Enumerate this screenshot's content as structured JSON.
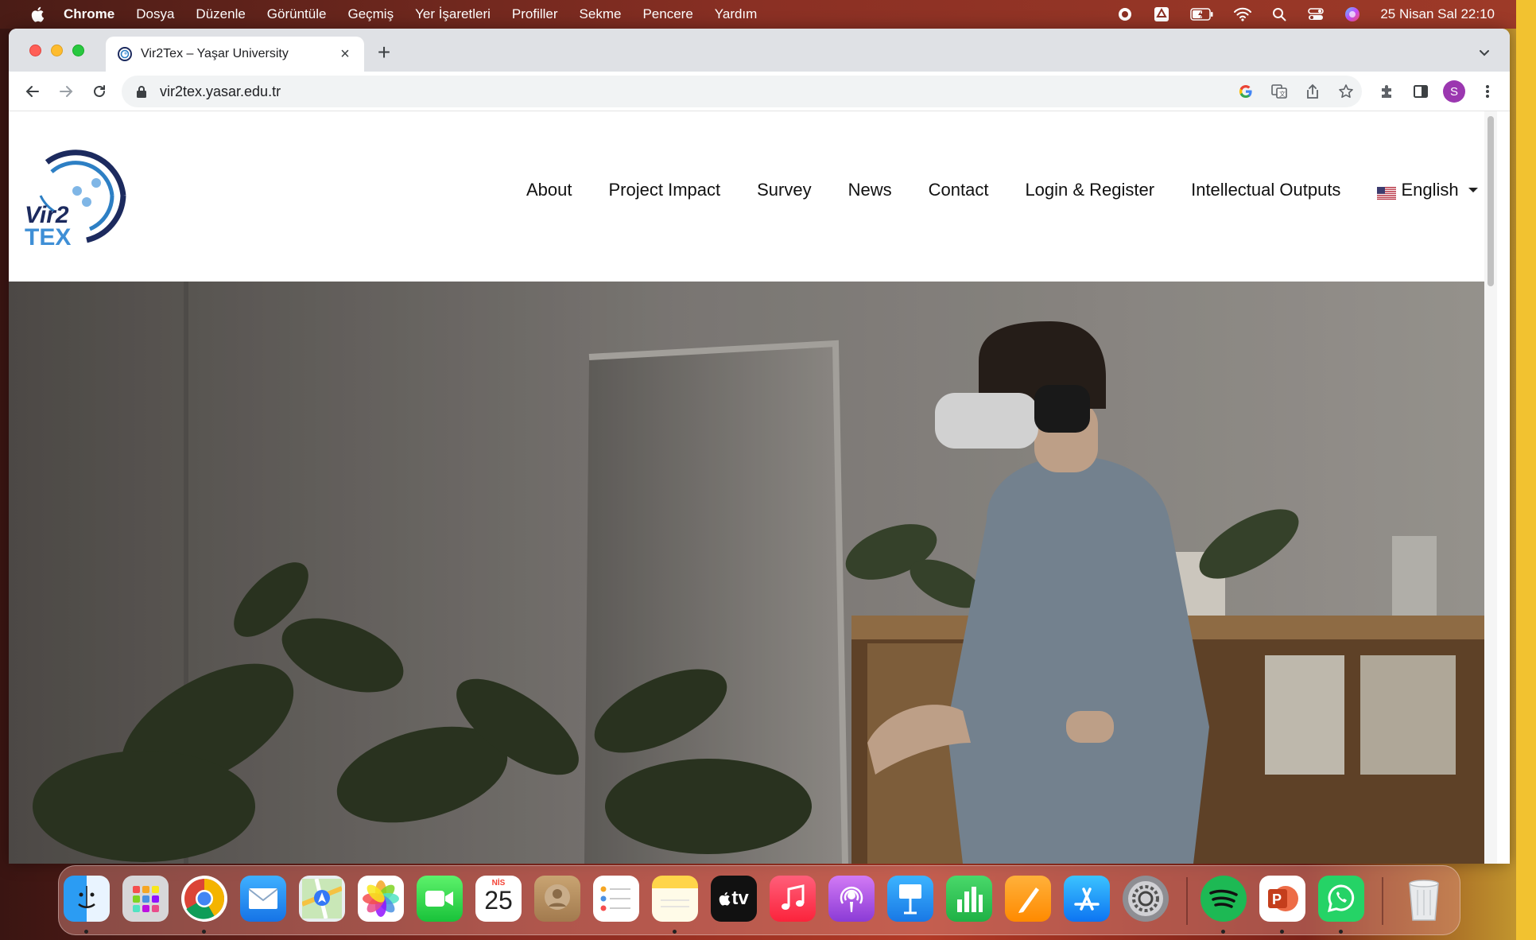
{
  "menubar": {
    "app": "Chrome",
    "items": [
      "Dosya",
      "Düzenle",
      "Görüntüle",
      "Geçmiş",
      "Yer İşaretleri",
      "Profiller",
      "Sekme",
      "Pencere",
      "Yardım"
    ],
    "status_icons": [
      "record-icon",
      "drive-icon",
      "battery-icon",
      "wifi-icon",
      "search-icon",
      "control-center-icon",
      "siri-icon"
    ],
    "clock": "25 Nisan Sal  22:10"
  },
  "browser": {
    "tab_title": "Vir2Tex – Yaşar University",
    "url": "vir2tex.yasar.edu.tr",
    "profile_initial": "S"
  },
  "site": {
    "logo_text_top": "Vir2",
    "logo_text_bottom": "TEX",
    "nav": [
      "About",
      "Project Impact",
      "Survey",
      "News",
      "Contact",
      "Login & Register",
      "Intellectual Outputs"
    ],
    "language": "English"
  },
  "dock": {
    "calendar_month": "NİS",
    "calendar_day": "25",
    "tv_label": "tv",
    "apps": [
      "finder",
      "launchpad",
      "chrome",
      "mail",
      "maps",
      "photos",
      "facetime",
      "calendar",
      "contacts",
      "reminders",
      "notes",
      "apple-tv",
      "music",
      "podcasts",
      "keynote",
      "numbers",
      "pages",
      "app-store",
      "system-settings",
      "spotify",
      "powerpoint",
      "whatsapp",
      "trash"
    ]
  },
  "colors": {
    "logo_navy": "#1c2a5e",
    "logo_blue": "#2d7fc4",
    "logo_light": "#7fb6e6",
    "avatar": "#9b37b0"
  }
}
